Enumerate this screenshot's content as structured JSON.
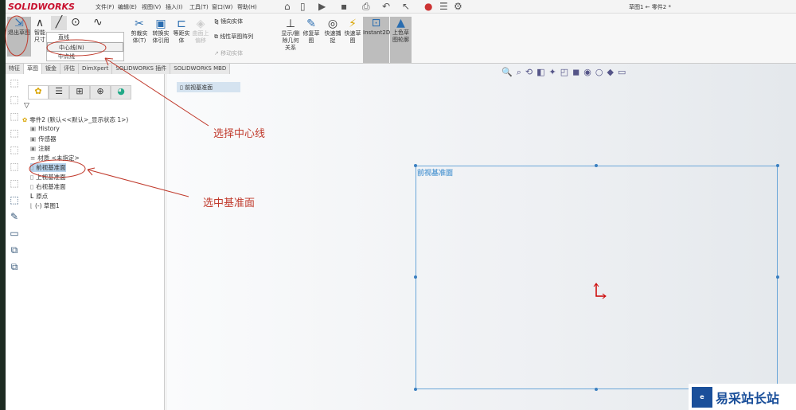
{
  "app": {
    "logo": "SOLIDWORKS",
    "doc_title": "草图1 ← 零件2 *"
  },
  "menu": [
    "文件(F)",
    "编辑(E)",
    "视图(V)",
    "插入(I)",
    "工具(T)",
    "窗口(W)",
    "帮助(H)"
  ],
  "ribbon": {
    "exit_sketch": "退出草图",
    "smart_dim": "智能尺寸",
    "trim": "剪裁实体(T)",
    "convert": "转换实体引用",
    "offset": "等距实体",
    "surface_offset": "曲面上偏移",
    "mirror": "镜向实体",
    "linear_pattern": "线性草图阵列",
    "move": "移动实体",
    "display_relations": "显示/删除几何关系",
    "repair": "修复草图",
    "quick_snap": "快速捕捉",
    "rapid_sketch": "快速草图",
    "instant2d": "Instant2D",
    "shaded_sketch": "上色草图轮廓"
  },
  "line_dropdown": [
    "直线",
    "中心线(N)",
    "中点线"
  ],
  "tabs": [
    "特征",
    "草图",
    "钣金",
    "评估",
    "DimXpert",
    "SOLIDWORKS 插件",
    "SOLIDWORKS MBD"
  ],
  "tree": {
    "root": "零件2 (默认<<默认>_显示状态 1>)",
    "items": [
      "History",
      "传感器",
      "注解",
      "材质 <未指定>",
      "前视基准面",
      "上视基准面",
      "右视基准面",
      "原点",
      "(-) 草图1"
    ]
  },
  "breadcrumb": "前视基准面",
  "viewport": {
    "plane_label": "前视基准面"
  },
  "annotations": {
    "select_centerline": "选择中心线",
    "select_plane": "选中基准面"
  },
  "watermark": "易采站长站",
  "colors": {
    "sketch": "#6aa6d8",
    "annotation": "#c0392b",
    "selection": "#b8d4ee"
  }
}
